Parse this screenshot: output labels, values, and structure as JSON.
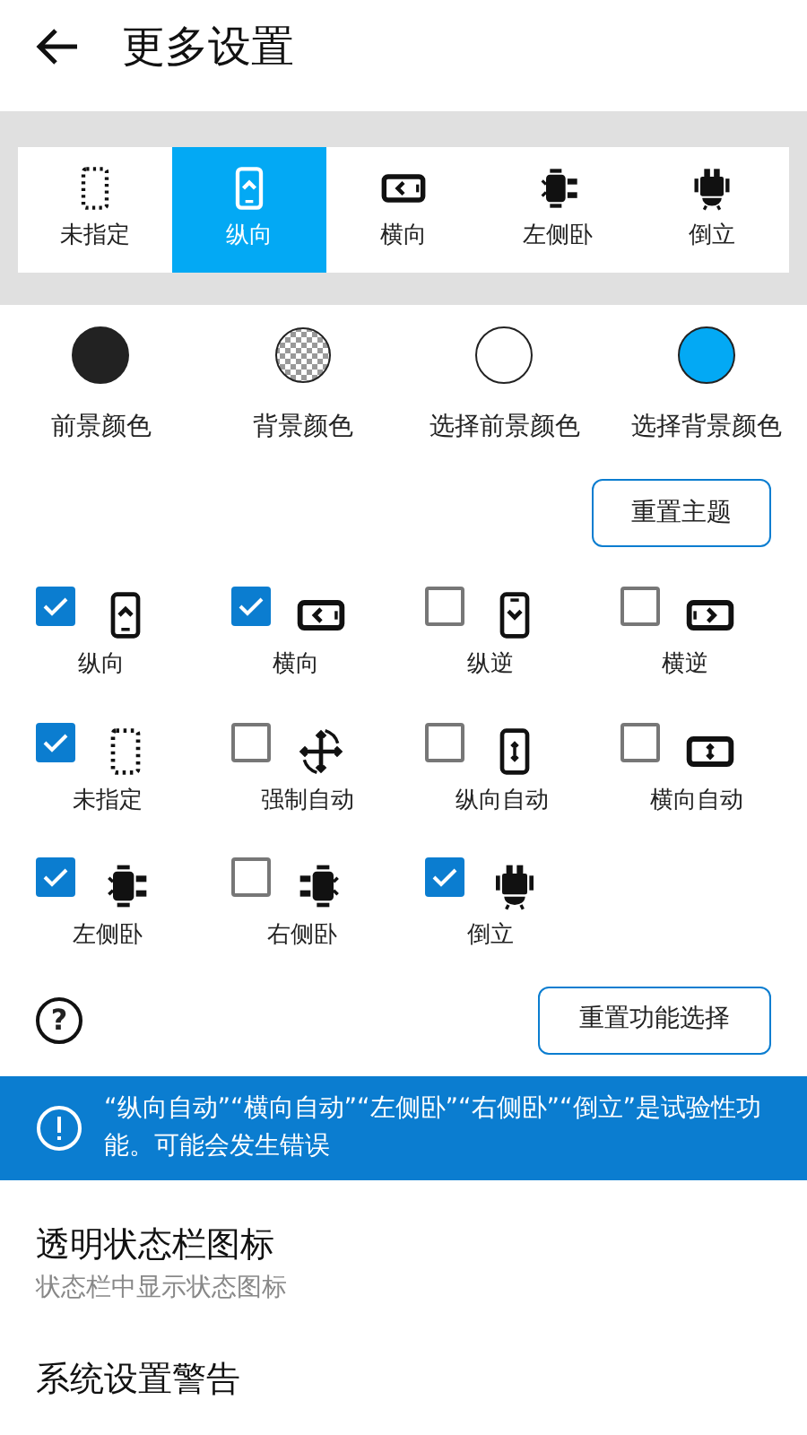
{
  "header": {
    "title": "更多设置"
  },
  "tabs": [
    {
      "label": "未指定",
      "kind": "dotted",
      "selected": false
    },
    {
      "label": "纵向",
      "kind": "portrait",
      "selected": true
    },
    {
      "label": "横向",
      "kind": "landscape",
      "selected": false
    },
    {
      "label": "左侧卧",
      "kind": "robot-left",
      "selected": false
    },
    {
      "label": "倒立",
      "kind": "robot-upside",
      "selected": false
    }
  ],
  "colors": [
    {
      "label": "前景颜色",
      "color": "#222222",
      "kind": "solid"
    },
    {
      "label": "背景颜色",
      "kind": "checker"
    },
    {
      "label": "选择前景颜色",
      "color": "#ffffff",
      "kind": "solid"
    },
    {
      "label": "选择背景颜色",
      "color": "#03a9f4",
      "kind": "solid"
    }
  ],
  "reset_theme_button": "重置主题",
  "orientations": [
    {
      "label": "纵向",
      "kind": "portrait",
      "checked": true
    },
    {
      "label": "横向",
      "kind": "landscape",
      "checked": true
    },
    {
      "label": "纵逆",
      "kind": "portrait-reverse",
      "checked": false
    },
    {
      "label": "横逆",
      "kind": "landscape-reverse",
      "checked": false
    },
    {
      "label": "未指定",
      "kind": "dotted",
      "checked": true
    },
    {
      "label": "强制自动",
      "kind": "rotate",
      "checked": false
    },
    {
      "label": "纵向自动",
      "kind": "portrait-auto",
      "checked": false
    },
    {
      "label": "横向自动",
      "kind": "landscape-auto",
      "checked": false
    },
    {
      "label": "左侧卧",
      "kind": "robot-left",
      "checked": true
    },
    {
      "label": "右侧卧",
      "kind": "robot-right",
      "checked": false
    },
    {
      "label": "倒立",
      "kind": "robot-upside",
      "checked": true
    }
  ],
  "help_icon": "?",
  "reset_functions_button": "重置功能选择",
  "notice": "“纵向自动”“横向自动”“左侧卧”“右侧卧”“倒立”是试验性功能。可能会发生错误",
  "settings": [
    {
      "title": "透明状态栏图标",
      "subtitle": "状态栏中显示状态图标"
    },
    {
      "title": "系统设置警告"
    }
  ]
}
